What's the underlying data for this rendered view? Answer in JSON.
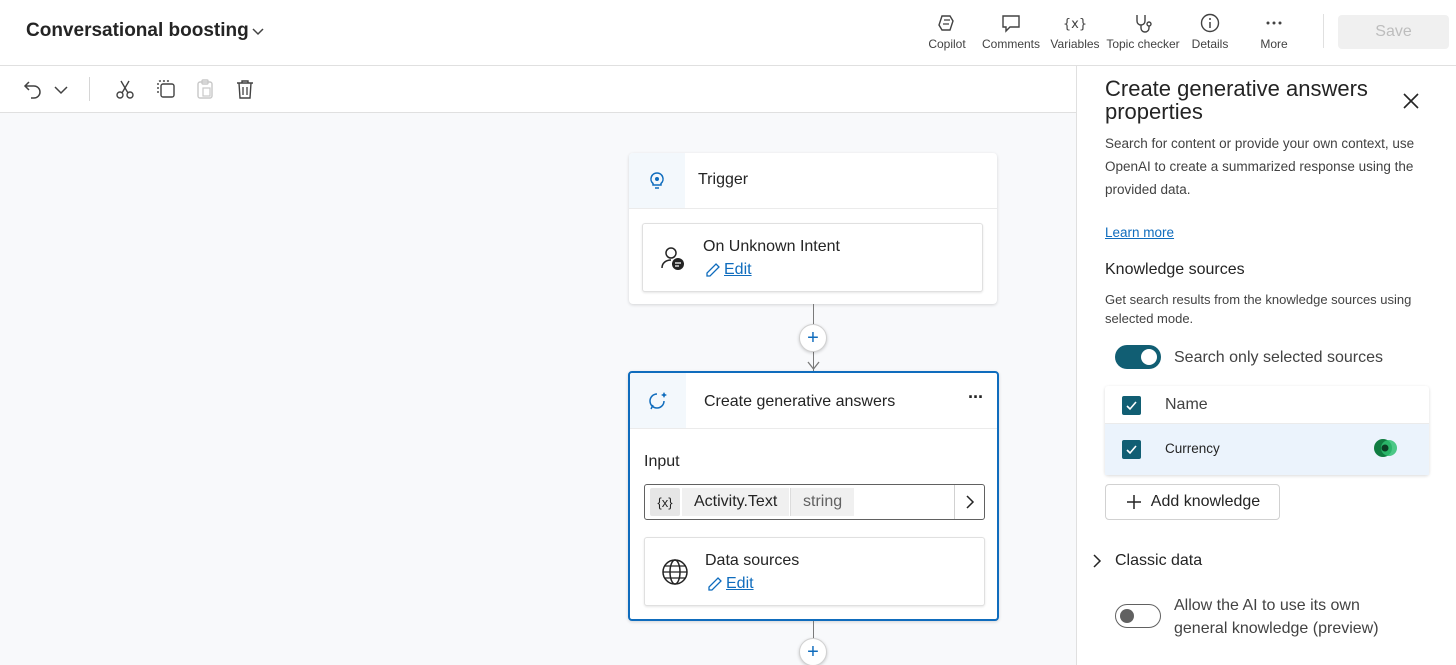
{
  "header": {
    "title": "Conversational boosting",
    "buttons": [
      {
        "label": "Copilot",
        "icon": "copilot-icon"
      },
      {
        "label": "Comments",
        "icon": "comment-icon"
      },
      {
        "label": "Variables",
        "icon": "variables-icon"
      },
      {
        "label": "Topic checker",
        "icon": "stethoscope-icon"
      },
      {
        "label": "Details",
        "icon": "info-icon"
      },
      {
        "label": "More",
        "icon": "more-icon"
      }
    ],
    "save_label": "Save"
  },
  "toolbar": {
    "icons": [
      "undo-icon",
      "chevron-down-icon",
      "cut-icon",
      "copy-icon",
      "paste-icon",
      "delete-icon"
    ]
  },
  "canvas": {
    "trigger_node": {
      "label": "Trigger",
      "card_title": "On Unknown Intent",
      "edit_label": "Edit"
    },
    "gen_node": {
      "label": "Create generative answers",
      "more": "···",
      "input_label": "Input",
      "var_chip": "{x}",
      "var_name": "Activity.Text",
      "var_type": "string",
      "card_title": "Data sources",
      "edit_label": "Edit"
    },
    "plus": "+"
  },
  "panel": {
    "title": "Create generative answers properties",
    "description": "Search for content or provide your own context, use OpenAI to create a summarized response using the provided data.",
    "learn_more": "Learn more",
    "knowledge_heading": "Knowledge sources",
    "knowledge_desc": "Get search results from the knowledge sources using selected mode.",
    "toggle_selected_label": "Search only selected sources",
    "toggle_selected_on": true,
    "table_header": "Name",
    "table_rows": [
      {
        "name": "Currency",
        "checked": true
      }
    ],
    "add_knowledge": "Add knowledge",
    "classic_data": "Classic data",
    "toggle_general_label": "Allow the AI to use its own general knowledge (preview)",
    "toggle_general_on": false
  },
  "colors": {
    "accent": "#115e73",
    "link": "#0f6cbd",
    "selected_row": "#ebf3fc"
  }
}
